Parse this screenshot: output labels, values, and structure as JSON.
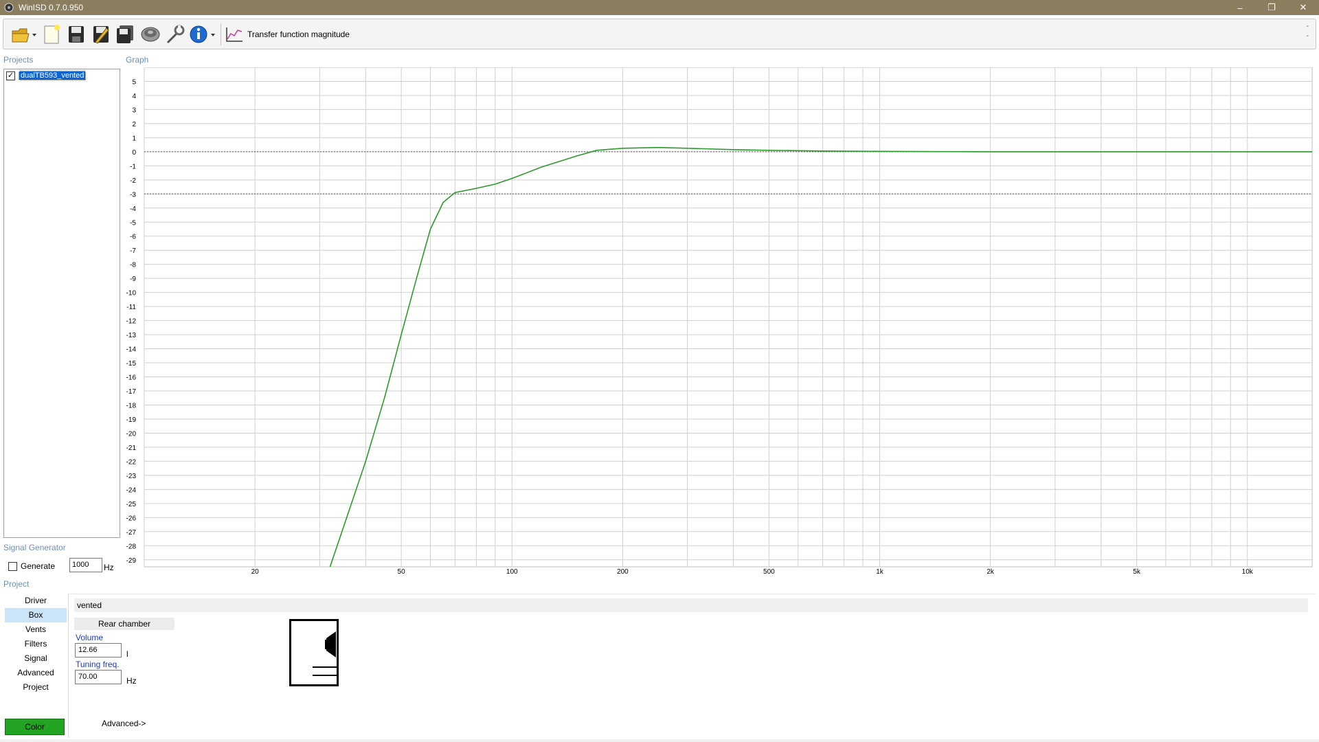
{
  "window": {
    "title": "WinISD 0.7.0.950",
    "minimize": "–",
    "maximize": "❐",
    "close": "✕"
  },
  "toolbar": {
    "graph_type_label": "Transfer function magnitude",
    "icons": [
      "open-folder-icon",
      "new-document-icon",
      "save-icon",
      "save-as-icon",
      "save-all-icon",
      "driver-icon",
      "tools-icon",
      "info-icon",
      "graph-icon"
    ],
    "collapse_top": "-",
    "collapse_bottom": "-"
  },
  "sections": {
    "projects": "Projects",
    "graph": "Graph",
    "signal_generator": "Signal Generator",
    "project": "Project"
  },
  "projects": [
    {
      "name": "dualTB593_vented",
      "checked": true,
      "selected": true
    }
  ],
  "signal_generator": {
    "generate_label": "Generate",
    "generate_checked": false,
    "frequency": "1000",
    "unit": "Hz"
  },
  "nav": {
    "items": [
      "Driver",
      "Box",
      "Vents",
      "Filters",
      "Signal",
      "Advanced",
      "Project"
    ],
    "active": "Box"
  },
  "color_button": {
    "label": "Color",
    "color": "#22a322"
  },
  "box": {
    "type": "vented",
    "chamber_tab": "Rear chamber",
    "volume_label": "Volume",
    "volume_value": "12.66",
    "volume_unit": "l",
    "tuning_label": "Tuning freq.",
    "tuning_value": "70.00",
    "tuning_unit": "Hz",
    "advanced_label": "Advanced->"
  },
  "chart_data": {
    "type": "line",
    "x_scale": "log",
    "xlim": [
      10,
      15000
    ],
    "ylim": [
      -29.5,
      6
    ],
    "y_ticks": [
      5,
      4,
      3,
      2,
      1,
      0,
      -1,
      -2,
      -3,
      -4,
      -5,
      -6,
      -7,
      -8,
      -9,
      -10,
      -11,
      -12,
      -13,
      -14,
      -15,
      -16,
      -17,
      -18,
      -19,
      -20,
      -21,
      -22,
      -23,
      -24,
      -25,
      -26,
      -27,
      -28,
      -29
    ],
    "x_tick_labels": [
      {
        "value": 20,
        "label": "20"
      },
      {
        "value": 50,
        "label": "50"
      },
      {
        "value": 100,
        "label": "100"
      },
      {
        "value": 200,
        "label": "200"
      },
      {
        "value": 500,
        "label": "500"
      },
      {
        "value": 1000,
        "label": "1k"
      },
      {
        "value": 2000,
        "label": "2k"
      },
      {
        "value": 5000,
        "label": "5k"
      },
      {
        "value": 10000,
        "label": "10k"
      }
    ],
    "grid": true,
    "reference_lines": [
      0,
      -3
    ],
    "series": [
      {
        "color": "#2b9a2b",
        "x": [
          32,
          35,
          40,
          45,
          50,
          55,
          60,
          65,
          70,
          80,
          90,
          100,
          120,
          150,
          170,
          200,
          250,
          300,
          400,
          500,
          700,
          1000,
          2000,
          5000,
          15000
        ],
        "y": [
          -29.5,
          -26.5,
          -22,
          -17.5,
          -13,
          -9,
          -5.5,
          -3.6,
          -2.9,
          -2.6,
          -2.3,
          -1.9,
          -1.1,
          -0.3,
          0.1,
          0.25,
          0.3,
          0.25,
          0.15,
          0.1,
          0.05,
          0.03,
          0,
          0,
          0
        ]
      }
    ]
  }
}
